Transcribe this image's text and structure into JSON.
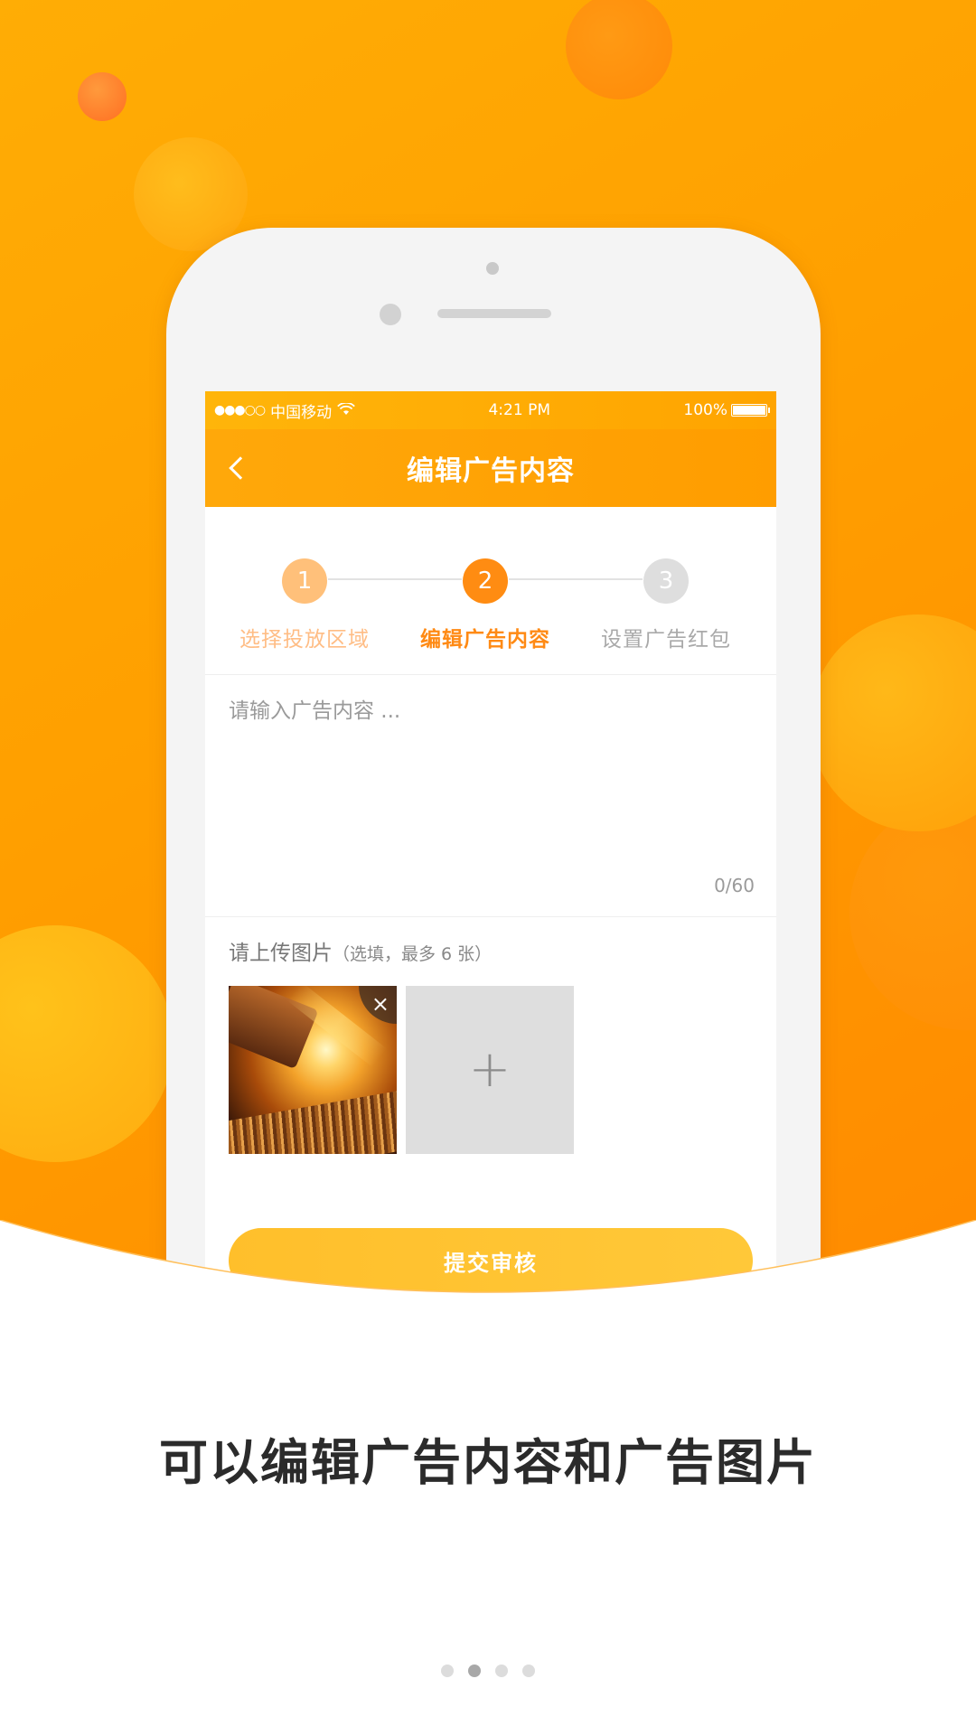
{
  "status_bar": {
    "signal": "●●●○○",
    "carrier": "中国移动",
    "time": "4:21 PM",
    "battery": "100%"
  },
  "nav": {
    "back_icon": "chevron-left-icon",
    "title": "编辑广告内容"
  },
  "steps": [
    {
      "number": "1",
      "label": "选择投放区域",
      "state": "done"
    },
    {
      "number": "2",
      "label": "编辑广告内容",
      "state": "active"
    },
    {
      "number": "3",
      "label": "设置广告红包",
      "state": "pending"
    }
  ],
  "content": {
    "placeholder": "请输入广告内容 ...",
    "value": "",
    "counter": "0/60"
  },
  "upload": {
    "title": "请上传图片",
    "hint": "（选填，最多 6 张）",
    "remove_icon": "×",
    "add_icon": "+"
  },
  "submit_label": "提交审核",
  "caption": "可以编辑广告内容和广告图片",
  "pager": {
    "count": 4,
    "active_index": 1
  },
  "colors": {
    "accent": "#ff9d00",
    "step_active": "#ff8c12",
    "step_done": "#ffc07a",
    "step_pending": "#dedede",
    "button": "#ffc239"
  }
}
